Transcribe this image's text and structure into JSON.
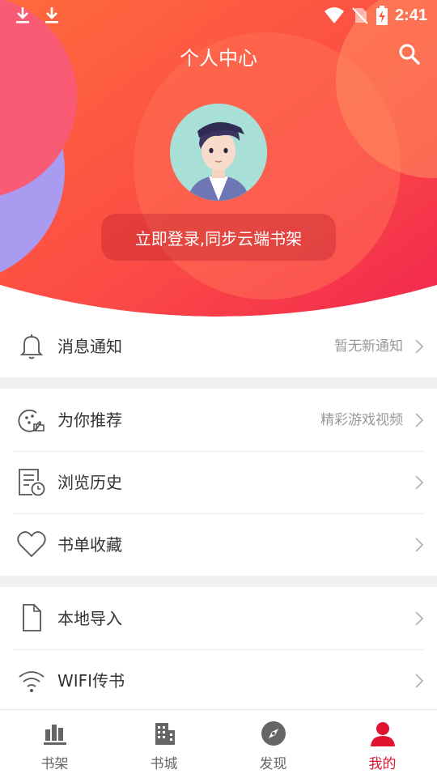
{
  "status_bar": {
    "time": "2:41"
  },
  "header": {
    "title": "个人中心",
    "login_prompt": "立即登录,同步云端书架"
  },
  "menu": {
    "notifications": {
      "label": "消息通知",
      "value": "暂无新通知"
    },
    "recommend": {
      "label": "为你推荐",
      "value": "精彩游戏视频"
    },
    "history": {
      "label": "浏览历史"
    },
    "favorites": {
      "label": "书单收藏"
    },
    "local_import": {
      "label": "本地导入"
    },
    "wifi_transfer": {
      "label": "WIFI传书"
    }
  },
  "tabbar": {
    "bookshelf": "书架",
    "bookstore": "书城",
    "discover": "发现",
    "mine": "我的"
  },
  "colors": {
    "accent": "#e0142e",
    "header_gradient_start": "#ff7a45",
    "header_gradient_end": "#f42a52"
  }
}
